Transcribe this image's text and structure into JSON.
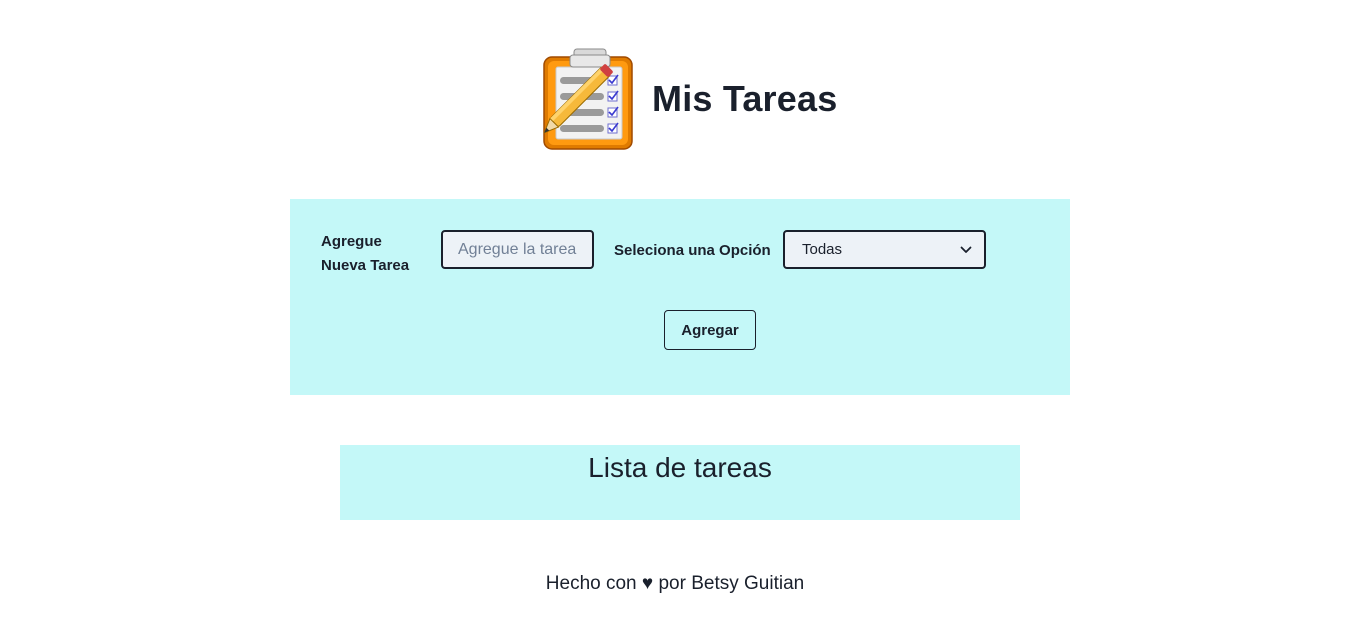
{
  "header": {
    "title": "Mis Tareas",
    "logo_icon": "clipboard-checklist-icon"
  },
  "form": {
    "task_label": "Agregue Nueva Tarea",
    "task_input": {
      "value": "",
      "placeholder": "Agregue la tarea"
    },
    "select_label": "Seleciona una Opción",
    "select": {
      "selected": "Todas",
      "icon": "chevron-down-icon"
    },
    "add_button_label": "Agregar"
  },
  "list": {
    "title": "Lista de tareas",
    "items": []
  },
  "footer": {
    "prefix": "Hecho con",
    "heart": "♥",
    "suffix": "por Betsy Guitian"
  },
  "colors": {
    "panel_background": "#c4f8f8",
    "text": "#1a202c",
    "input_background": "#edf2f7"
  }
}
